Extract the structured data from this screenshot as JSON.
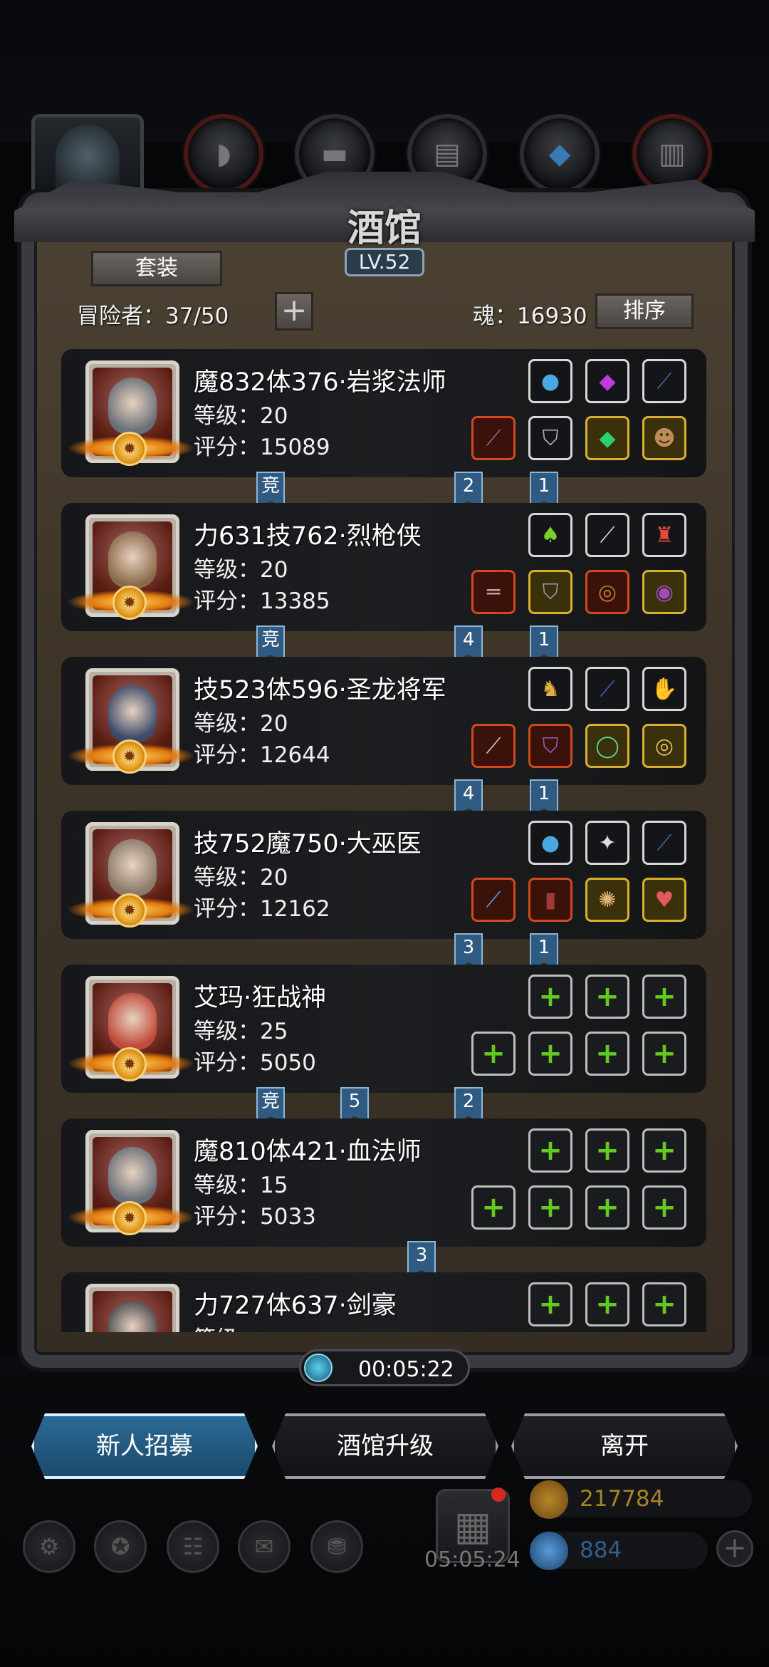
{
  "header": {
    "title": "酒馆",
    "level": "LV.52",
    "set_button": "套装",
    "adventurers_label": "冒险者：37/50",
    "add_button": "+",
    "soul_label": "魂：16930",
    "sort_button": "排序"
  },
  "top_tabs": [
    "hero-portrait",
    "leather-armor-icon",
    "wood-icon",
    "iron-icon",
    "crystal-icon",
    "stone-icon"
  ],
  "heroes": [
    {
      "name": "魔832体376·岩浆法师",
      "level": "等级：20",
      "score": "评分：15089",
      "slots_top": [
        "blue-orb-icon",
        "purple-gem-icon",
        "bow-icon"
      ],
      "slots_bottom": [
        "staff-icon",
        "armor-icon",
        "emerald-icon",
        "mask-icon"
      ],
      "tags": [
        {
          "text": "竞",
          "pos": "left"
        },
        {
          "text": "2",
          "pos": "mid"
        },
        {
          "text": "1",
          "pos": "right"
        }
      ]
    },
    {
      "name": "力631技762·烈枪侠",
      "level": "等级：20",
      "score": "评分：13385",
      "slots_top": [
        "green-potion-icon",
        "dagger-icon",
        "trophy-icon"
      ],
      "slots_bottom": [
        "rifle-icon",
        "plate-armor-icon",
        "ring-icon",
        "amulet-icon"
      ],
      "tags": [
        {
          "text": "竞",
          "pos": "left"
        },
        {
          "text": "4",
          "pos": "mid"
        },
        {
          "text": "1",
          "pos": "right"
        }
      ]
    },
    {
      "name": "技523体596·圣龙将军",
      "level": "等级：20",
      "score": "评分：12644",
      "slots_top": [
        "golden-helm-icon",
        "bow-icon",
        "gauntlet-icon"
      ],
      "slots_bottom": [
        "sword-icon",
        "purple-armor-icon",
        "jade-ring-icon",
        "gold-ring-icon"
      ],
      "tags": [
        {
          "text": "4",
          "pos": "mid"
        },
        {
          "text": "1",
          "pos": "right"
        }
      ]
    },
    {
      "name": "技752魔750·大巫医",
      "level": "等级：20",
      "score": "评分：12162",
      "slots_top": [
        "blue-orb-icon",
        "rune-icon",
        "bow-icon"
      ],
      "slots_bottom": [
        "wand-icon",
        "robe-icon",
        "medallion-icon",
        "heart-gem-icon"
      ],
      "tags": [
        {
          "text": "3",
          "pos": "mid"
        },
        {
          "text": "1",
          "pos": "right"
        }
      ]
    },
    {
      "name": "艾玛·狂战神",
      "level": "等级：25",
      "score": "评分：5050",
      "slots_top": [
        "empty",
        "empty",
        "empty"
      ],
      "slots_bottom": [
        "empty",
        "empty",
        "empty",
        "empty"
      ],
      "tags": [
        {
          "text": "竞",
          "pos": "left"
        },
        {
          "text": "5",
          "pos": "mid2"
        },
        {
          "text": "2",
          "pos": "mid"
        }
      ]
    },
    {
      "name": "魔810体421·血法师",
      "level": "等级：15",
      "score": "评分：5033",
      "slots_top": [
        "empty",
        "empty",
        "empty"
      ],
      "slots_bottom": [
        "empty",
        "empty",
        "empty",
        "empty"
      ],
      "tags": [
        {
          "text": "3",
          "pos": "mid3"
        }
      ]
    },
    {
      "name": "力727体637·剑豪",
      "level": "等级：",
      "score": "",
      "slots_top": [
        "empty",
        "empty",
        "empty"
      ],
      "slots_bottom": [],
      "tags": []
    }
  ],
  "empty_slot_symbol": "+",
  "timer": "00:05:22",
  "buttons": {
    "recruit": "新人招募",
    "upgrade": "酒馆升级",
    "leave": "离开"
  },
  "bottom": {
    "icons": [
      "settings-icon",
      "trophy-icon",
      "quest-icon",
      "mail-icon",
      "shop-icon"
    ],
    "gift_timer": "05:05:24",
    "gold": "217784",
    "gems": "884"
  },
  "colors": {
    "gold_text": "#a88324",
    "gem_text": "#2f5f8c",
    "accent_blue": "#4ab8ff"
  }
}
